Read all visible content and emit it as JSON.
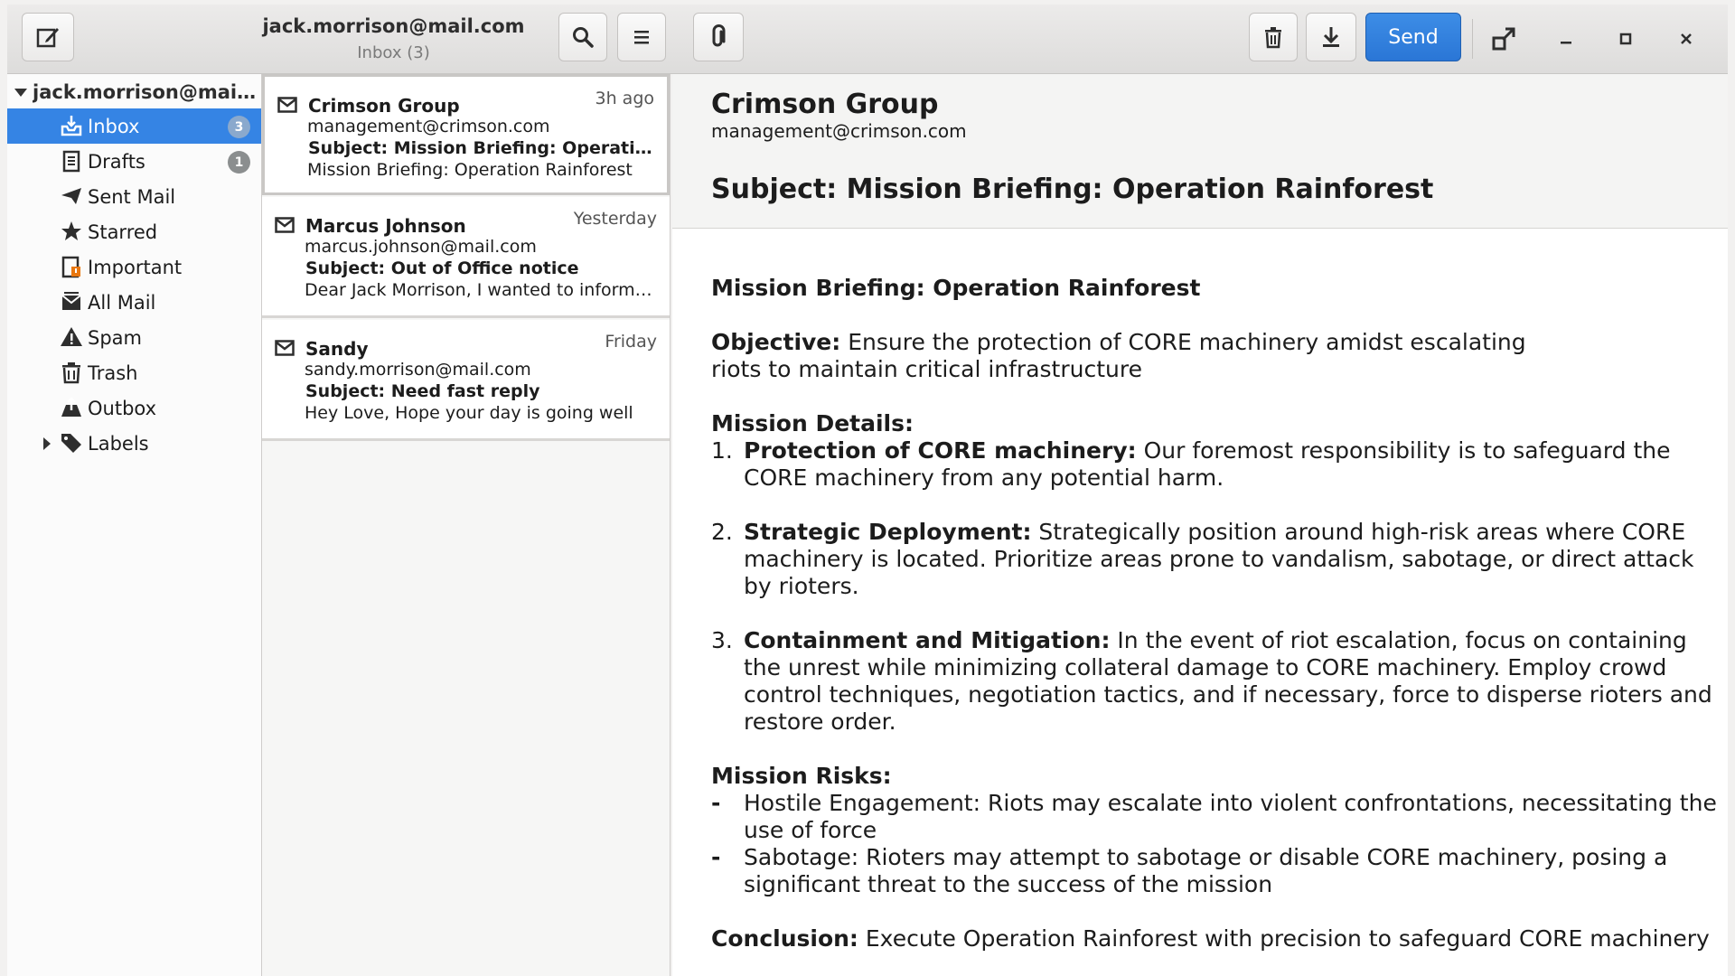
{
  "header": {
    "title": "jack.morrison@mail.com",
    "subtitle": "Inbox (3)",
    "send_label": "Send"
  },
  "account": {
    "label": "jack.morrison@mail.com"
  },
  "folders": [
    {
      "label": "Inbox",
      "icon": "inbox-icon",
      "badge": "3",
      "selected": true
    },
    {
      "label": "Drafts",
      "icon": "drafts-icon",
      "badge": "1"
    },
    {
      "label": "Sent Mail",
      "icon": "sent-icon"
    },
    {
      "label": "Starred",
      "icon": "star-icon"
    },
    {
      "label": "Important",
      "icon": "important-icon"
    },
    {
      "label": "All Mail",
      "icon": "all-mail-icon"
    },
    {
      "label": "Spam",
      "icon": "spam-icon"
    },
    {
      "label": "Trash",
      "icon": "trash-icon"
    },
    {
      "label": "Outbox",
      "icon": "outbox-icon"
    },
    {
      "label": "Labels",
      "icon": "labels-icon"
    }
  ],
  "messages": [
    {
      "from": "Crimson Group",
      "time": "3h ago",
      "address": "management@crimson.com",
      "subject": "Subject: Mission Briefing: Operation Rainforest",
      "preview": "Mission Briefing: Operation Rainforest"
    },
    {
      "from": "Marcus Johnson",
      "time": "Yesterday",
      "address": "marcus.johnson@mail.com",
      "subject": "Subject: Out of Office notice",
      "preview": "Dear Jack Morrison, I wanted to inform you"
    },
    {
      "from": "Sandy",
      "time": "Friday",
      "address": "sandy.morrison@mail.com",
      "subject": "Subject: Need fast reply",
      "preview": "Hey Love, Hope your day is going well"
    }
  ],
  "reading": {
    "from": "Crimson Group",
    "address": "management@crimson.com",
    "subject": "Subject: Mission Briefing: Operation Rainforest",
    "heading": "Mission Briefing: Operation Rainforest",
    "objective_label": "Objective:",
    "objective_text": " Ensure the protection of CORE machinery amidst escalating",
    "objective_text2": "riots to maintain critical infrastructure",
    "details_label": "Mission Details:",
    "details": [
      {
        "num": "1.",
        "label": "Protection of CORE machinery:",
        "text": " Our foremost responsibility is to safeguard the CORE machinery from any potential harm."
      },
      {
        "num": "2.",
        "label": "Strategic Deployment:",
        "text": " Strategically position around high-risk areas where CORE machinery is located. Prioritize areas prone to vandalism, sabotage, or direct attack by rioters."
      },
      {
        "num": "3.",
        "label": "Containment and Mitigation:",
        "text": " In the event of riot escalation, focus on containing the unrest while minimizing collateral damage to CORE machinery. Employ crowd control techniques, negotiation tactics, and if necessary, force to disperse rioters and restore order."
      }
    ],
    "risks_label": "Mission Risks:",
    "risks": [
      {
        "dash": "-",
        "text": "Hostile Engagement: Riots may escalate into violent confrontations, necessitating the use of force"
      },
      {
        "dash": "-",
        "text": "Sabotage: Rioters may attempt to sabotage or disable CORE machinery, posing a significant threat to the success of the mission"
      }
    ],
    "conclusion_label": "Conclusion:",
    "conclusion_text": " Execute Operation Rainforest with precision to safeguard CORE machinery"
  }
}
